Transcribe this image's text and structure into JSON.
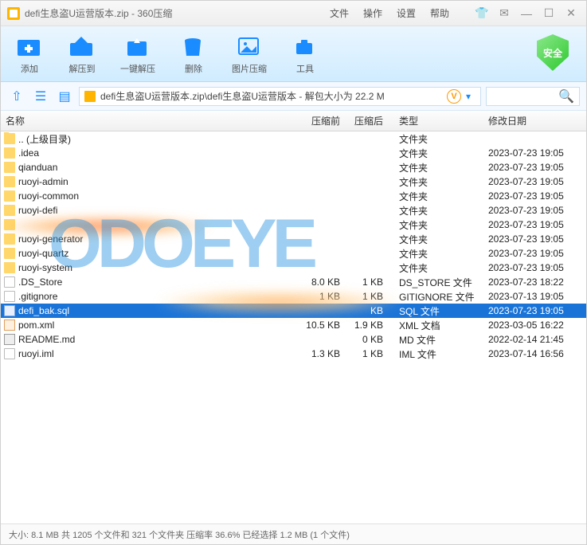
{
  "window": {
    "title": "defi生息盗U运营版本.zip - 360压缩"
  },
  "menu": {
    "file": "文件",
    "operate": "操作",
    "settings": "设置",
    "help": "帮助"
  },
  "toolbar": {
    "add": "添加",
    "extract_to": "解压到",
    "one_click": "一键解压",
    "delete": "删除",
    "image_compress": "图片压缩",
    "tools": "工具",
    "safe": "安全"
  },
  "address": {
    "path": "defi生息盗U运营版本.zip\\defi生息盗U运营版本 - 解包大小为 22.2 M"
  },
  "columns": {
    "name": "名称",
    "before": "压缩前",
    "after": "压缩后",
    "type": "类型",
    "date": "修改日期"
  },
  "rows": [
    {
      "name": ".. (上级目录)",
      "before": "",
      "after": "",
      "type": "文件夹",
      "date": "",
      "icon": "folder"
    },
    {
      "name": ".idea",
      "before": "",
      "after": "",
      "type": "文件夹",
      "date": "2023-07-23 19:05",
      "icon": "folder"
    },
    {
      "name": "qianduan",
      "before": "",
      "after": "",
      "type": "文件夹",
      "date": "2023-07-23 19:05",
      "icon": "folder"
    },
    {
      "name": "ruoyi-admin",
      "before": "",
      "after": "",
      "type": "文件夹",
      "date": "2023-07-23 19:05",
      "icon": "folder"
    },
    {
      "name": "ruoyi-common",
      "before": "",
      "after": "",
      "type": "文件夹",
      "date": "2023-07-23 19:05",
      "icon": "folder"
    },
    {
      "name": "ruoyi-defi",
      "before": "",
      "after": "",
      "type": "文件夹",
      "date": "2023-07-23 19:05",
      "icon": "folder"
    },
    {
      "name": "",
      "before": "",
      "after": "",
      "type": "文件夹",
      "date": "2023-07-23 19:05",
      "icon": "folder"
    },
    {
      "name": "ruoyi-generator",
      "before": "",
      "after": "",
      "type": "文件夹",
      "date": "2023-07-23 19:05",
      "icon": "folder"
    },
    {
      "name": "ruoyi-quartz",
      "before": "",
      "after": "",
      "type": "文件夹",
      "date": "2023-07-23 19:05",
      "icon": "folder"
    },
    {
      "name": "ruoyi-system",
      "before": "",
      "after": "",
      "type": "文件夹",
      "date": "2023-07-23 19:05",
      "icon": "folder"
    },
    {
      "name": ".DS_Store",
      "before": "8.0 KB",
      "after": "1 KB",
      "type": "DS_STORE 文件",
      "date": "2023-07-23 18:22",
      "icon": "file"
    },
    {
      "name": ".gitignore",
      "before": "1 KB",
      "after": "1 KB",
      "type": "GITIGNORE 文件",
      "date": "2023-07-13 19:05",
      "icon": "file"
    },
    {
      "name": "defi_bak.sql",
      "before": "",
      "after": "KB",
      "type": "SQL 文件",
      "date": "2023-07-23 19:05",
      "icon": "sql",
      "selected": true
    },
    {
      "name": "pom.xml",
      "before": "10.5 KB",
      "after": "1.9 KB",
      "type": "XML 文档",
      "date": "2023-03-05 16:22",
      "icon": "xml"
    },
    {
      "name": "README.md",
      "before": "",
      "after": "0 KB",
      "type": "MD 文件",
      "date": "2022-02-14 21:45",
      "icon": "md"
    },
    {
      "name": "ruoyi.iml",
      "before": "1.3 KB",
      "after": "1 KB",
      "type": "IML 文件",
      "date": "2023-07-14 16:56",
      "icon": "file"
    }
  ],
  "status": {
    "text": "大小: 8.1 MB 共 1205 个文件和 321 个文件夹 压缩率 36.6%  已经选择 1.2 MB (1 个文件)"
  },
  "watermark": "ODOEYE"
}
